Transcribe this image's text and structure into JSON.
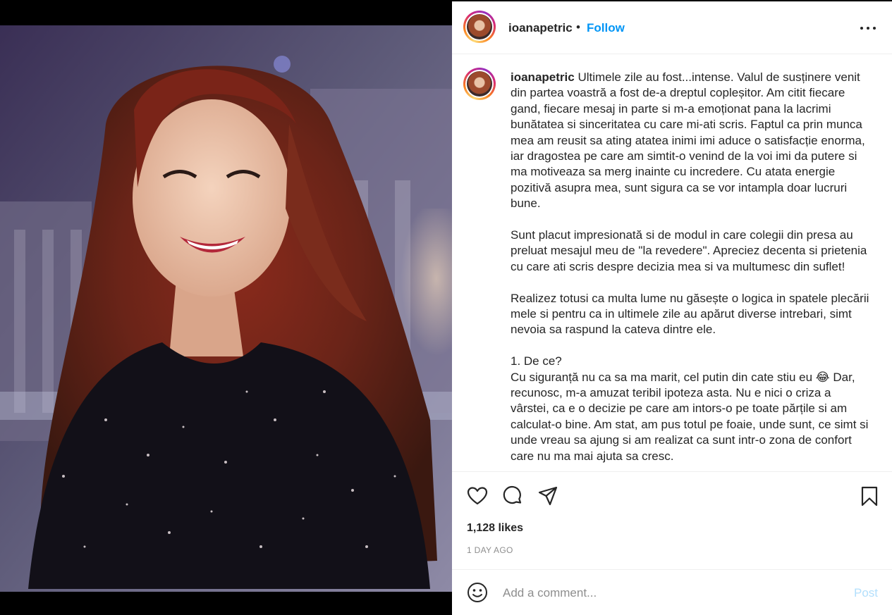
{
  "post": {
    "username": "ioanapetric",
    "separator": "•",
    "follow_label": "Follow",
    "image_alt": "Photo by ioanapetric",
    "caption_paragraphs": [
      "Ultimele zile au fost...intense. Valul de susținere venit din partea voastră a fost de-a dreptul copleșitor. Am citit fiecare gand, fiecare mesaj in parte si m-a emoționat pana la lacrimi bunătatea si sinceritatea cu care mi-ati scris. Faptul ca prin munca mea am reusit sa ating atatea inimi imi aduce o satisfacție enorma, iar dragostea pe care am simtit-o venind de la voi imi da putere si ma motiveaza sa merg inainte cu incredere. Cu atata energie pozitivă asupra mea, sunt sigura ca se vor intampla doar lucruri bune.",
      "Sunt placut impresionată si de modul in care colegii din presa au preluat mesajul meu de \"la revedere\". Apreciez decenta si prietenia cu care ati scris despre decizia mea si va multumesc din suflet!",
      "Realizez totusi ca multa lume nu găsește o logica in spatele plecării mele si pentru ca in ultimele zile au apărut diverse intrebari, simt nevoia sa raspund la cateva dintre ele.",
      "1. De ce?\nCu siguranță nu ca sa ma marit, cel putin din cate stiu eu 😂 Dar, recunosc, m-a amuzat teribil ipoteza asta. Nu e nici o criza a vârstei, ca e o decizie pe care am intors-o pe toate părțile si am calculat-o bine. Am stat, am pus totul pe foaie, unde sunt, ce simt si unde vreau sa ajung si am realizat ca sunt intr-o zona de confort care nu ma mai ajuta sa cresc."
    ],
    "likes": "1,128 likes",
    "timestamp": "1 DAY AGO"
  },
  "icons": {
    "more": "more-options-icon",
    "like": "heart-icon",
    "comment": "comment-icon",
    "share": "send-icon",
    "save": "bookmark-icon",
    "emoji": "emoji-icon"
  },
  "comment": {
    "placeholder": "Add a comment...",
    "post_label": "Post"
  },
  "colors": {
    "accent": "#0095f6",
    "post_disabled": "#b2dffc",
    "text": "#262626",
    "muted": "#8e8e8e",
    "divider": "#efefef"
  }
}
